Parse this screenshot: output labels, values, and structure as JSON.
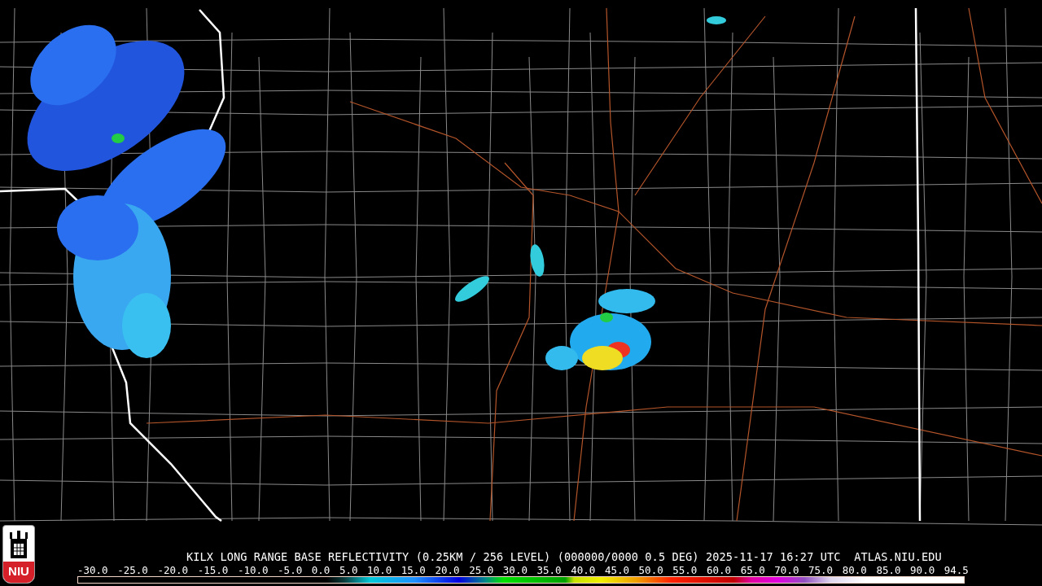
{
  "logo": {
    "text": "NIU"
  },
  "caption": "KILX LONG RANGE BASE REFLECTIVITY (0.25KM / 256 LEVEL) (000000/0000 0.5 DEG) 2025-11-17 16:27 UTC  ATLAS.NIU.EDU",
  "legend": {
    "labels": [
      "-30.0",
      "-25.0",
      "-20.0",
      "-15.0",
      "-10.0",
      "-5.0",
      "0.0",
      "5.0",
      "10.0",
      "15.0",
      "20.0",
      "25.0",
      "30.0",
      "35.0",
      "40.0",
      "45.0",
      "50.0",
      "55.0",
      "60.0",
      "65.0",
      "70.0",
      "75.0",
      "80.0",
      "85.0",
      "90.0",
      "94.5"
    ]
  }
}
